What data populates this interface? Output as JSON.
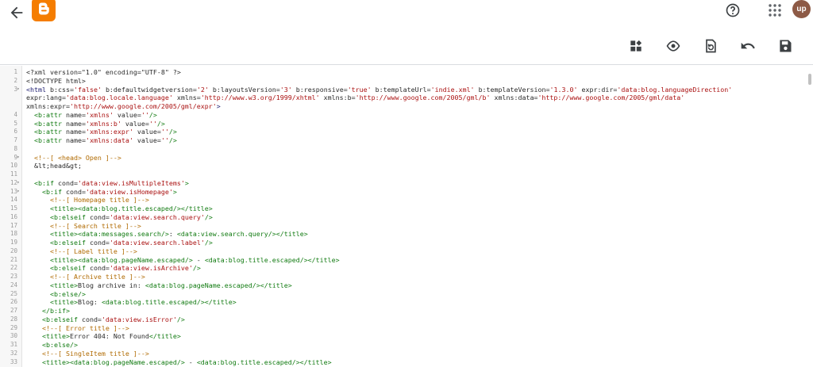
{
  "header": {
    "back_icon": "arrow-left-icon",
    "logo_icon": "blogger-logo-icon",
    "help_icon": "help-circle-icon",
    "apps_icon": "apps-grid-icon",
    "avatar_text": "up",
    "brand_color": "#f57d00"
  },
  "toolbar": {
    "buttons": [
      {
        "name": "widgets-button",
        "icon": "widgets-icon"
      },
      {
        "name": "preview-button",
        "icon": "eye-icon"
      },
      {
        "name": "restore-button",
        "icon": "restore-icon"
      },
      {
        "name": "undo-button",
        "icon": "undo-icon"
      },
      {
        "name": "save-button",
        "icon": "save-icon"
      }
    ]
  },
  "editor": {
    "lines": [
      {
        "n": "1",
        "fold": "",
        "html": "<span class=\"a\">&lt;?xml version=\"1.0\" encoding=\"UTF-8\" ?&gt;</span>"
      },
      {
        "n": "2",
        "fold": "",
        "html": "<span class=\"a\">&lt;!DOCTYPE html&gt;</span>"
      },
      {
        "n": "3",
        "fold": "▾",
        "html": "<span class=\"t\">&lt;html</span> <span class=\"a\">b:css=</span><span class=\"s\">'false'</span> <span class=\"a\">b:defaultwidgetversion=</span><span class=\"s\">'2'</span> <span class=\"a\">b:layoutsVersion=</span><span class=\"s\">'3'</span> <span class=\"a\">b:responsive=</span><span class=\"s\">'true'</span> <span class=\"a\">b:templateUrl=</span><span class=\"s\">'indie.xml'</span> <span class=\"a\">b:templateVersion=</span><span class=\"s\">'1.3.0'</span> <span class=\"a\">expr:dir=</span><span class=\"s\">'data:blog.languageDirection'</span>"
      },
      {
        "n": "",
        "fold": "",
        "html": "<span class=\"a\">expr:lang=</span><span class=\"s\">'data:blog.locale.language'</span> <span class=\"a\">xmlns=</span><span class=\"s\">'http://www.w3.org/1999/xhtml'</span> <span class=\"a\">xmlns:b=</span><span class=\"s\">'http://www.google.com/2005/gml/b'</span> <span class=\"a\">xmlns:data=</span><span class=\"s\">'http://www.google.com/2005/gml/data'</span>"
      },
      {
        "n": "",
        "fold": "",
        "html": "<span class=\"a\">xmlns:expr=</span><span class=\"s\">'http://www.google.com/2005/gml/expr'</span><span class=\"t\">&gt;</span>"
      },
      {
        "n": "4",
        "fold": "",
        "html": "  <span class=\"g\">&lt;b:attr</span> <span class=\"a\">name=</span><span class=\"s\">'xmlns'</span> <span class=\"a\">value=</span><span class=\"s\">''</span><span class=\"g\">/&gt;</span>"
      },
      {
        "n": "5",
        "fold": "",
        "html": "  <span class=\"g\">&lt;b:attr</span> <span class=\"a\">name=</span><span class=\"s\">'xmlns:b'</span> <span class=\"a\">value=</span><span class=\"s\">''</span><span class=\"g\">/&gt;</span>"
      },
      {
        "n": "6",
        "fold": "",
        "html": "  <span class=\"g\">&lt;b:attr</span> <span class=\"a\">name=</span><span class=\"s\">'xmlns:expr'</span> <span class=\"a\">value=</span><span class=\"s\">''</span><span class=\"g\">/&gt;</span>"
      },
      {
        "n": "7",
        "fold": "",
        "html": "  <span class=\"g\">&lt;b:attr</span> <span class=\"a\">name=</span><span class=\"s\">'xmlns:data'</span> <span class=\"a\">value=</span><span class=\"s\">''</span><span class=\"g\">/&gt;</span>"
      },
      {
        "n": "8",
        "fold": "",
        "html": ""
      },
      {
        "n": "9",
        "fold": "▾",
        "html": "  <span class=\"c\">&lt;!--[ &lt;head&gt; Open ]--&gt;</span>"
      },
      {
        "n": "10",
        "fold": "",
        "html": "  <span class=\"a\">&amp;lt;head&amp;gt;</span>"
      },
      {
        "n": "11",
        "fold": "",
        "html": ""
      },
      {
        "n": "12",
        "fold": "▾",
        "html": "  <span class=\"g\">&lt;b:if</span> <span class=\"a\">cond=</span><span class=\"s\">'data:view.isMultipleItems'</span><span class=\"g\">&gt;</span>"
      },
      {
        "n": "13",
        "fold": "▾",
        "html": "    <span class=\"g\">&lt;b:if</span> <span class=\"a\">cond=</span><span class=\"s\">'data:view.isHomepage'</span><span class=\"g\">&gt;</span>"
      },
      {
        "n": "14",
        "fold": "",
        "html": "      <span class=\"c\">&lt;!--[ Homepage title ]--&gt;</span>"
      },
      {
        "n": "15",
        "fold": "",
        "html": "      <span class=\"g\">&lt;title&gt;&lt;data:blog.title.escaped/&gt;&lt;/title&gt;</span>"
      },
      {
        "n": "16",
        "fold": "",
        "html": "      <span class=\"g\">&lt;b:elseif</span> <span class=\"a\">cond=</span><span class=\"s\">'data:view.search.query'</span><span class=\"g\">/&gt;</span>"
      },
      {
        "n": "17",
        "fold": "",
        "html": "      <span class=\"c\">&lt;!--[ Search title ]--&gt;</span>"
      },
      {
        "n": "18",
        "fold": "",
        "html": "      <span class=\"g\">&lt;title&gt;&lt;data:messages.search/&gt;</span><span class=\"a\">: </span><span class=\"g\">&lt;data:view.search.query/&gt;&lt;/title&gt;</span>"
      },
      {
        "n": "19",
        "fold": "",
        "html": "      <span class=\"g\">&lt;b:elseif</span> <span class=\"a\">cond=</span><span class=\"s\">'data:view.search.label'</span><span class=\"g\">/&gt;</span>"
      },
      {
        "n": "20",
        "fold": "",
        "html": "      <span class=\"c\">&lt;!--[ Label title ]--&gt;</span>"
      },
      {
        "n": "21",
        "fold": "",
        "html": "      <span class=\"g\">&lt;title&gt;&lt;data:blog.pageName.escaped/&gt;</span><span class=\"a\"> - </span><span class=\"g\">&lt;data:blog.title.escaped/&gt;&lt;/title&gt;</span>"
      },
      {
        "n": "22",
        "fold": "",
        "html": "      <span class=\"g\">&lt;b:elseif</span> <span class=\"a\">cond=</span><span class=\"s\">'data:view.isArchive'</span><span class=\"g\">/&gt;</span>"
      },
      {
        "n": "23",
        "fold": "",
        "html": "      <span class=\"c\">&lt;!--[ Archive title ]--&gt;</span>"
      },
      {
        "n": "24",
        "fold": "",
        "html": "      <span class=\"g\">&lt;title&gt;</span><span class=\"a\">Blog archive in: </span><span class=\"g\">&lt;data:blog.pageName.escaped/&gt;&lt;/title&gt;</span>"
      },
      {
        "n": "25",
        "fold": "",
        "html": "      <span class=\"g\">&lt;b:else/&gt;</span>"
      },
      {
        "n": "26",
        "fold": "",
        "html": "      <span class=\"g\">&lt;title&gt;</span><span class=\"a\">Blog: </span><span class=\"g\">&lt;data:blog.title.escaped/&gt;&lt;/title&gt;</span>"
      },
      {
        "n": "27",
        "fold": "",
        "html": "    <span class=\"g\">&lt;/b:if&gt;</span>"
      },
      {
        "n": "28",
        "fold": "",
        "html": "    <span class=\"g\">&lt;b:elseif</span> <span class=\"a\">cond=</span><span class=\"s\">'data:view.isError'</span><span class=\"g\">/&gt;</span>"
      },
      {
        "n": "29",
        "fold": "",
        "html": "    <span class=\"c\">&lt;!--[ Error title ]--&gt;</span>"
      },
      {
        "n": "30",
        "fold": "",
        "html": "    <span class=\"g\">&lt;title&gt;</span><span class=\"a\">Error 404: Not Found</span><span class=\"g\">&lt;/title&gt;</span>"
      },
      {
        "n": "31",
        "fold": "",
        "html": "    <span class=\"g\">&lt;b:else/&gt;</span>"
      },
      {
        "n": "32",
        "fold": "",
        "html": "    <span class=\"c\">&lt;!--[ SingleItem title ]--&gt;</span>"
      },
      {
        "n": "33",
        "fold": "",
        "html": "    <span class=\"g\">&lt;title&gt;&lt;data:blog.pageName.escaped/&gt;</span><span class=\"a\"> - </span><span class=\"g\">&lt;data:blog.title.escaped/&gt;&lt;/title&gt;</span>"
      }
    ]
  }
}
